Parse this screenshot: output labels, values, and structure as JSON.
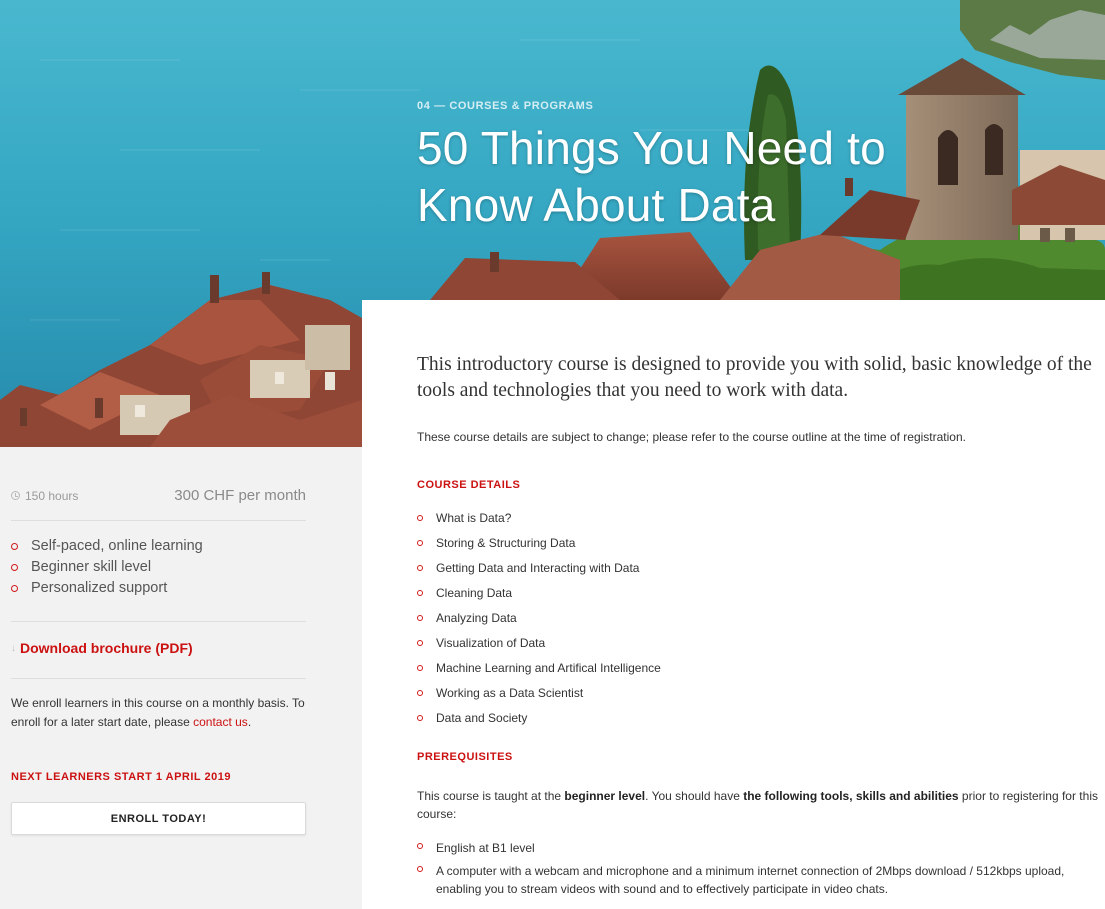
{
  "hero": {
    "eyebrow": "04 — COURSES & PROGRAMS",
    "title_line1": "50 Things You Need to",
    "title_line2": "Know About Data"
  },
  "sidebar": {
    "duration": "150 hours",
    "price": "300 CHF per month",
    "features": [
      "Self-paced, online learning",
      "Beginner skill level",
      "Personalized support"
    ],
    "download_label": "Download brochure (PDF)",
    "enroll_note_prefix": "We enroll learners in this course on a monthly basis. To enroll for a later start date, please ",
    "enroll_note_link": "contact us",
    "enroll_note_suffix": ".",
    "next_start": "NEXT LEARNERS START 1 APRIL 2019",
    "enroll_button": "ENROLL TODAY!"
  },
  "main": {
    "intro_line1": "This introductory course is designed to provide you with solid, basic knowledge of the",
    "intro_line2": "tools and technologies that you need to work with data.",
    "disclaimer": "These course details are subject to change; please refer to the course outline at the time of registration.",
    "course_details_heading": "COURSE DETAILS",
    "course_details": [
      "What is Data?",
      "Storing & Structuring Data",
      "Getting Data and Interacting with Data",
      "Cleaning Data",
      "Analyzing Data",
      "Visualization of Data",
      "Machine Learning and Artifical Intelligence",
      "Working as a Data Scientist",
      "Data and Society"
    ],
    "prerequisites_heading": "PREREQUISITES",
    "prereq_text_1": "This course is taught at the ",
    "prereq_bold_1": "beginner level",
    "prereq_text_2": ". You should have ",
    "prereq_bold_2": "the following tools, skills and abilities",
    "prereq_text_3": " prior to registering for this course:",
    "prerequisites": [
      "English at B1 level",
      "A computer with a webcam and microphone and a minimum internet connection of 2Mbps download / 512kbps upload, enabling you to stream videos with sound and to effectively participate in video chats."
    ]
  },
  "colors": {
    "accent": "#cc1111",
    "sidebar_bg": "#f2f2f2",
    "lake": "#2f9fbd"
  },
  "icons": [
    "clock-icon",
    "bullet-circle-icon",
    "download-arrow-icon"
  ]
}
